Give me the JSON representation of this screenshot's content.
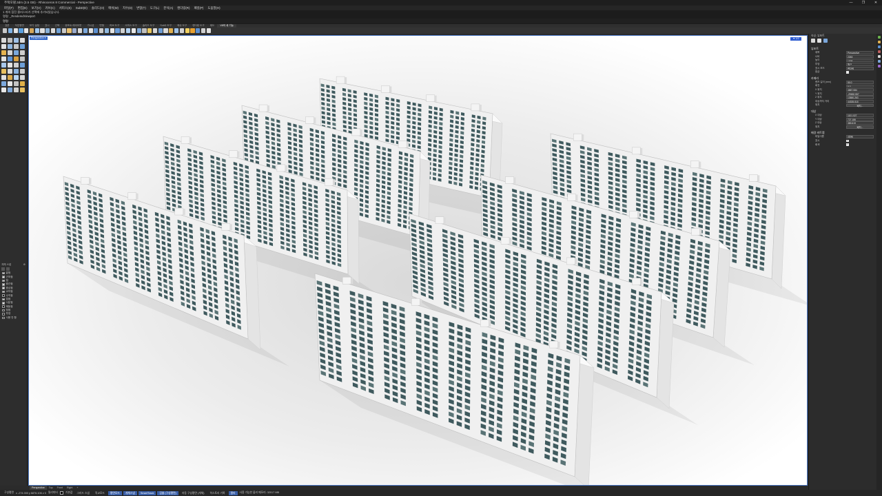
{
  "window": {
    "title": "주택모델.3dm (3.5 GB) - Rhinoceros 8 Commercial - Perspective",
    "controls": [
      "—",
      "❐",
      "✕"
    ]
  },
  "menu": [
    "파일(F)",
    "편집(E)",
    "보기(V)",
    "커브(C)",
    "서피스(S)",
    "SubD(D)",
    "솔리드(O)",
    "메쉬(M)",
    "치수(D)",
    "변형(T)",
    "도구(L)",
    "분석(A)",
    "렌더링(R)",
    "패널(P)",
    "도움말(H)"
  ],
  "command_history": {
    "lines": [
      "1 개의 점진 클러스터가 선택에 추가되었습니다.",
      "명령: _RenderedViewport"
    ],
    "prompt": "명령:"
  },
  "toolbar_tabs": [
    "표준",
    "작업평면",
    "보기 설정",
    "표시",
    "선택",
    "뷰포트 레이아웃",
    "가시성",
    "변형",
    "커브 도구",
    "서피스 도구",
    "솔리드 도구",
    "SubD 도구",
    "메쉬 도구",
    "렌더링 도구",
    "제도",
    "V8의 새 기능"
  ],
  "toolbar_active_tab": "V8의 새 기능",
  "toolbar_icon_colors": [
    "#c9c9c9",
    "#7fb2e5",
    "#e3e3e3",
    "#5aa0e0",
    "#e6e6e6",
    "#d4a65a",
    "#a0c8f0",
    "#e0e0e0",
    "#88b0d8",
    "#dcdcdc",
    "#6fa0d6",
    "#c8c8c8",
    "#e8c070",
    "#9ac",
    "#d8d8d8",
    "#7aa6da",
    "#e2e2e2",
    "#5b8fd0",
    "#ccc",
    "#8fb8e0",
    "#e4e4e4",
    "#6a9cd8",
    "#d0d0d0",
    "#b0d0f0",
    "#e8e8e8",
    "#7ea8d8",
    "#c0c0c0",
    "#e8c860",
    "#d6d6d6",
    "#6e9ed6",
    "#dadada",
    "#e0b050",
    "#9cc0e8",
    "#d2d2d2",
    "#f0d060",
    "#e8a030",
    "#5c8fd0",
    "#cfcfcf",
    "#e0e0e0"
  ],
  "left_tool_colors": [
    "#d8d8d8",
    "#c0c0c0",
    "#9fc0e6",
    "#dcdcdc",
    "#e0e0e0",
    "#8fb6e0",
    "#c8c8c8",
    "#6da0d8",
    "#e6b450",
    "#d4d4d4",
    "#7aa8dc",
    "#cfcfcf",
    "#e2e2e2",
    "#5f94d4",
    "#d8a040",
    "#c6c6c6",
    "#a8c8ec",
    "#e4e4e4",
    "#d0d0d0",
    "#6d9fd8",
    "#e8c060",
    "#dadada",
    "#8ab2de",
    "#cccccc",
    "#e0e0e0",
    "#d8a84a",
    "#b8d4f0",
    "#d4d4d4",
    "#7ca8dc",
    "#e6e6e6",
    "#c4c4c4",
    "#e0b048",
    "#e8e8e8",
    "#7fa8d8",
    "#d2d2d2",
    "#e8c060"
  ],
  "osnap": {
    "title": "개체 스냅",
    "pin": "⚙",
    "items": [
      {
        "label": "끝점",
        "checked": true
      },
      {
        "label": "근처점",
        "checked": true
      },
      {
        "label": "점",
        "checked": true
      },
      {
        "label": "중간점",
        "checked": true
      },
      {
        "label": "중심점",
        "checked": true
      },
      {
        "label": "교차점",
        "checked": true
      },
      {
        "label": "수직점",
        "checked": false
      },
      {
        "label": "접점",
        "checked": true
      },
      {
        "label": "사분점",
        "checked": true
      },
      {
        "label": "매듭점",
        "checked": false
      },
      {
        "label": "정점",
        "checked": false
      },
      {
        "label": "투영",
        "checked": false
      },
      {
        "label": "사용 안 함",
        "checked": false
      }
    ]
  },
  "viewport": {
    "label": "Perspective ▾",
    "gumball_badge": "▼ 1/2",
    "background": "#ffffff",
    "building_count": 8
  },
  "viewport_tabs": [
    "Perspective",
    "Top",
    "Front",
    "Right",
    "+"
  ],
  "status_bar": {
    "cplane": "구성평면",
    "coords": "x -274.000  y 6876.106  z 0",
    "units": "밀리미터",
    "layer": "기본값",
    "toggles": [
      {
        "label": "그리드 스냅",
        "on": false
      },
      {
        "label": "직교모드",
        "on": false
      },
      {
        "label": "평면모드",
        "on": true
      },
      {
        "label": "개체스냅",
        "on": true
      },
      {
        "label": "SmartTrack",
        "on": true
      },
      {
        "label": "검볼 (구성평면)",
        "on": true
      },
      {
        "label": "자동 구성평면 (개체)",
        "on": false
      },
      {
        "label": "히스토리 기록",
        "on": false
      },
      {
        "label": "필터",
        "on": true
      }
    ],
    "message": "사용 가능한 물리 메모리: 32017 MB"
  },
  "right_panel": {
    "header": "속성: 뷰포트",
    "sections": [
      {
        "title": "뷰포트",
        "rows": [
          {
            "label": "제목",
            "value": "Perspective",
            "kind": "field"
          },
          {
            "label": "너비",
            "value": "2263",
            "kind": "field"
          },
          {
            "label": "높이",
            "value": "1308",
            "kind": "field"
          },
          {
            "label": "투영",
            "value": "원근",
            "kind": "field"
          },
          {
            "label": "표시 모드",
            "value": "렌더링",
            "kind": "field"
          },
          {
            "label": "잠금",
            "value": "",
            "kind": "checkbox",
            "checked": false
          }
        ]
      },
      {
        "title": "카메라",
        "rows": [
          {
            "label": "렌즈 길이 (mm)",
            "value": "50.0",
            "kind": "field"
          },
          {
            "label": "회전",
            "value": "0.0",
            "kind": "field"
          },
          {
            "label": "X 위치",
            "value": "4867.084",
            "kind": "field"
          },
          {
            "label": "Y 위치",
            "value": "-29652.557",
            "kind": "field"
          },
          {
            "label": "Z 위치",
            "value": "13580.263",
            "kind": "field"
          },
          {
            "label": "대상까지 거리",
            "value": "44335.018",
            "kind": "field"
          },
          {
            "label": "위치",
            "value": "배치...",
            "kind": "button"
          }
        ]
      },
      {
        "title": "대상",
        "rows": [
          {
            "label": "X 대상",
            "value": "1101.027",
            "kind": "field"
          },
          {
            "label": "Y 대상",
            "value": "727.186",
            "kind": "field"
          },
          {
            "label": "Z 대상",
            "value": "389.619",
            "kind": "field"
          },
          {
            "label": "위치",
            "value": "배치...",
            "kind": "button"
          }
        ]
      },
      {
        "title": "배경 비트맵",
        "rows": [
          {
            "label": "파일이름",
            "value": "(없음)",
            "kind": "field"
          },
          {
            "label": "표시",
            "value": "",
            "kind": "checkbox",
            "checked": true
          },
          {
            "label": "회색",
            "value": "",
            "kind": "checkbox",
            "checked": true
          }
        ]
      }
    ],
    "icon_colors": [
      "#d8d8d8",
      "#e0e0e0",
      "#7aa6da"
    ]
  },
  "far_right_icon_colors": [
    "#6ab04c",
    "#e0b050",
    "#5c8fd0",
    "#c06060",
    "#d8d8d8",
    "#7aa6da",
    "#9c6ad0"
  ],
  "colors": {
    "accent": "#3367c8",
    "facade": "#f2f2f2",
    "window": "#3f5a5e"
  }
}
